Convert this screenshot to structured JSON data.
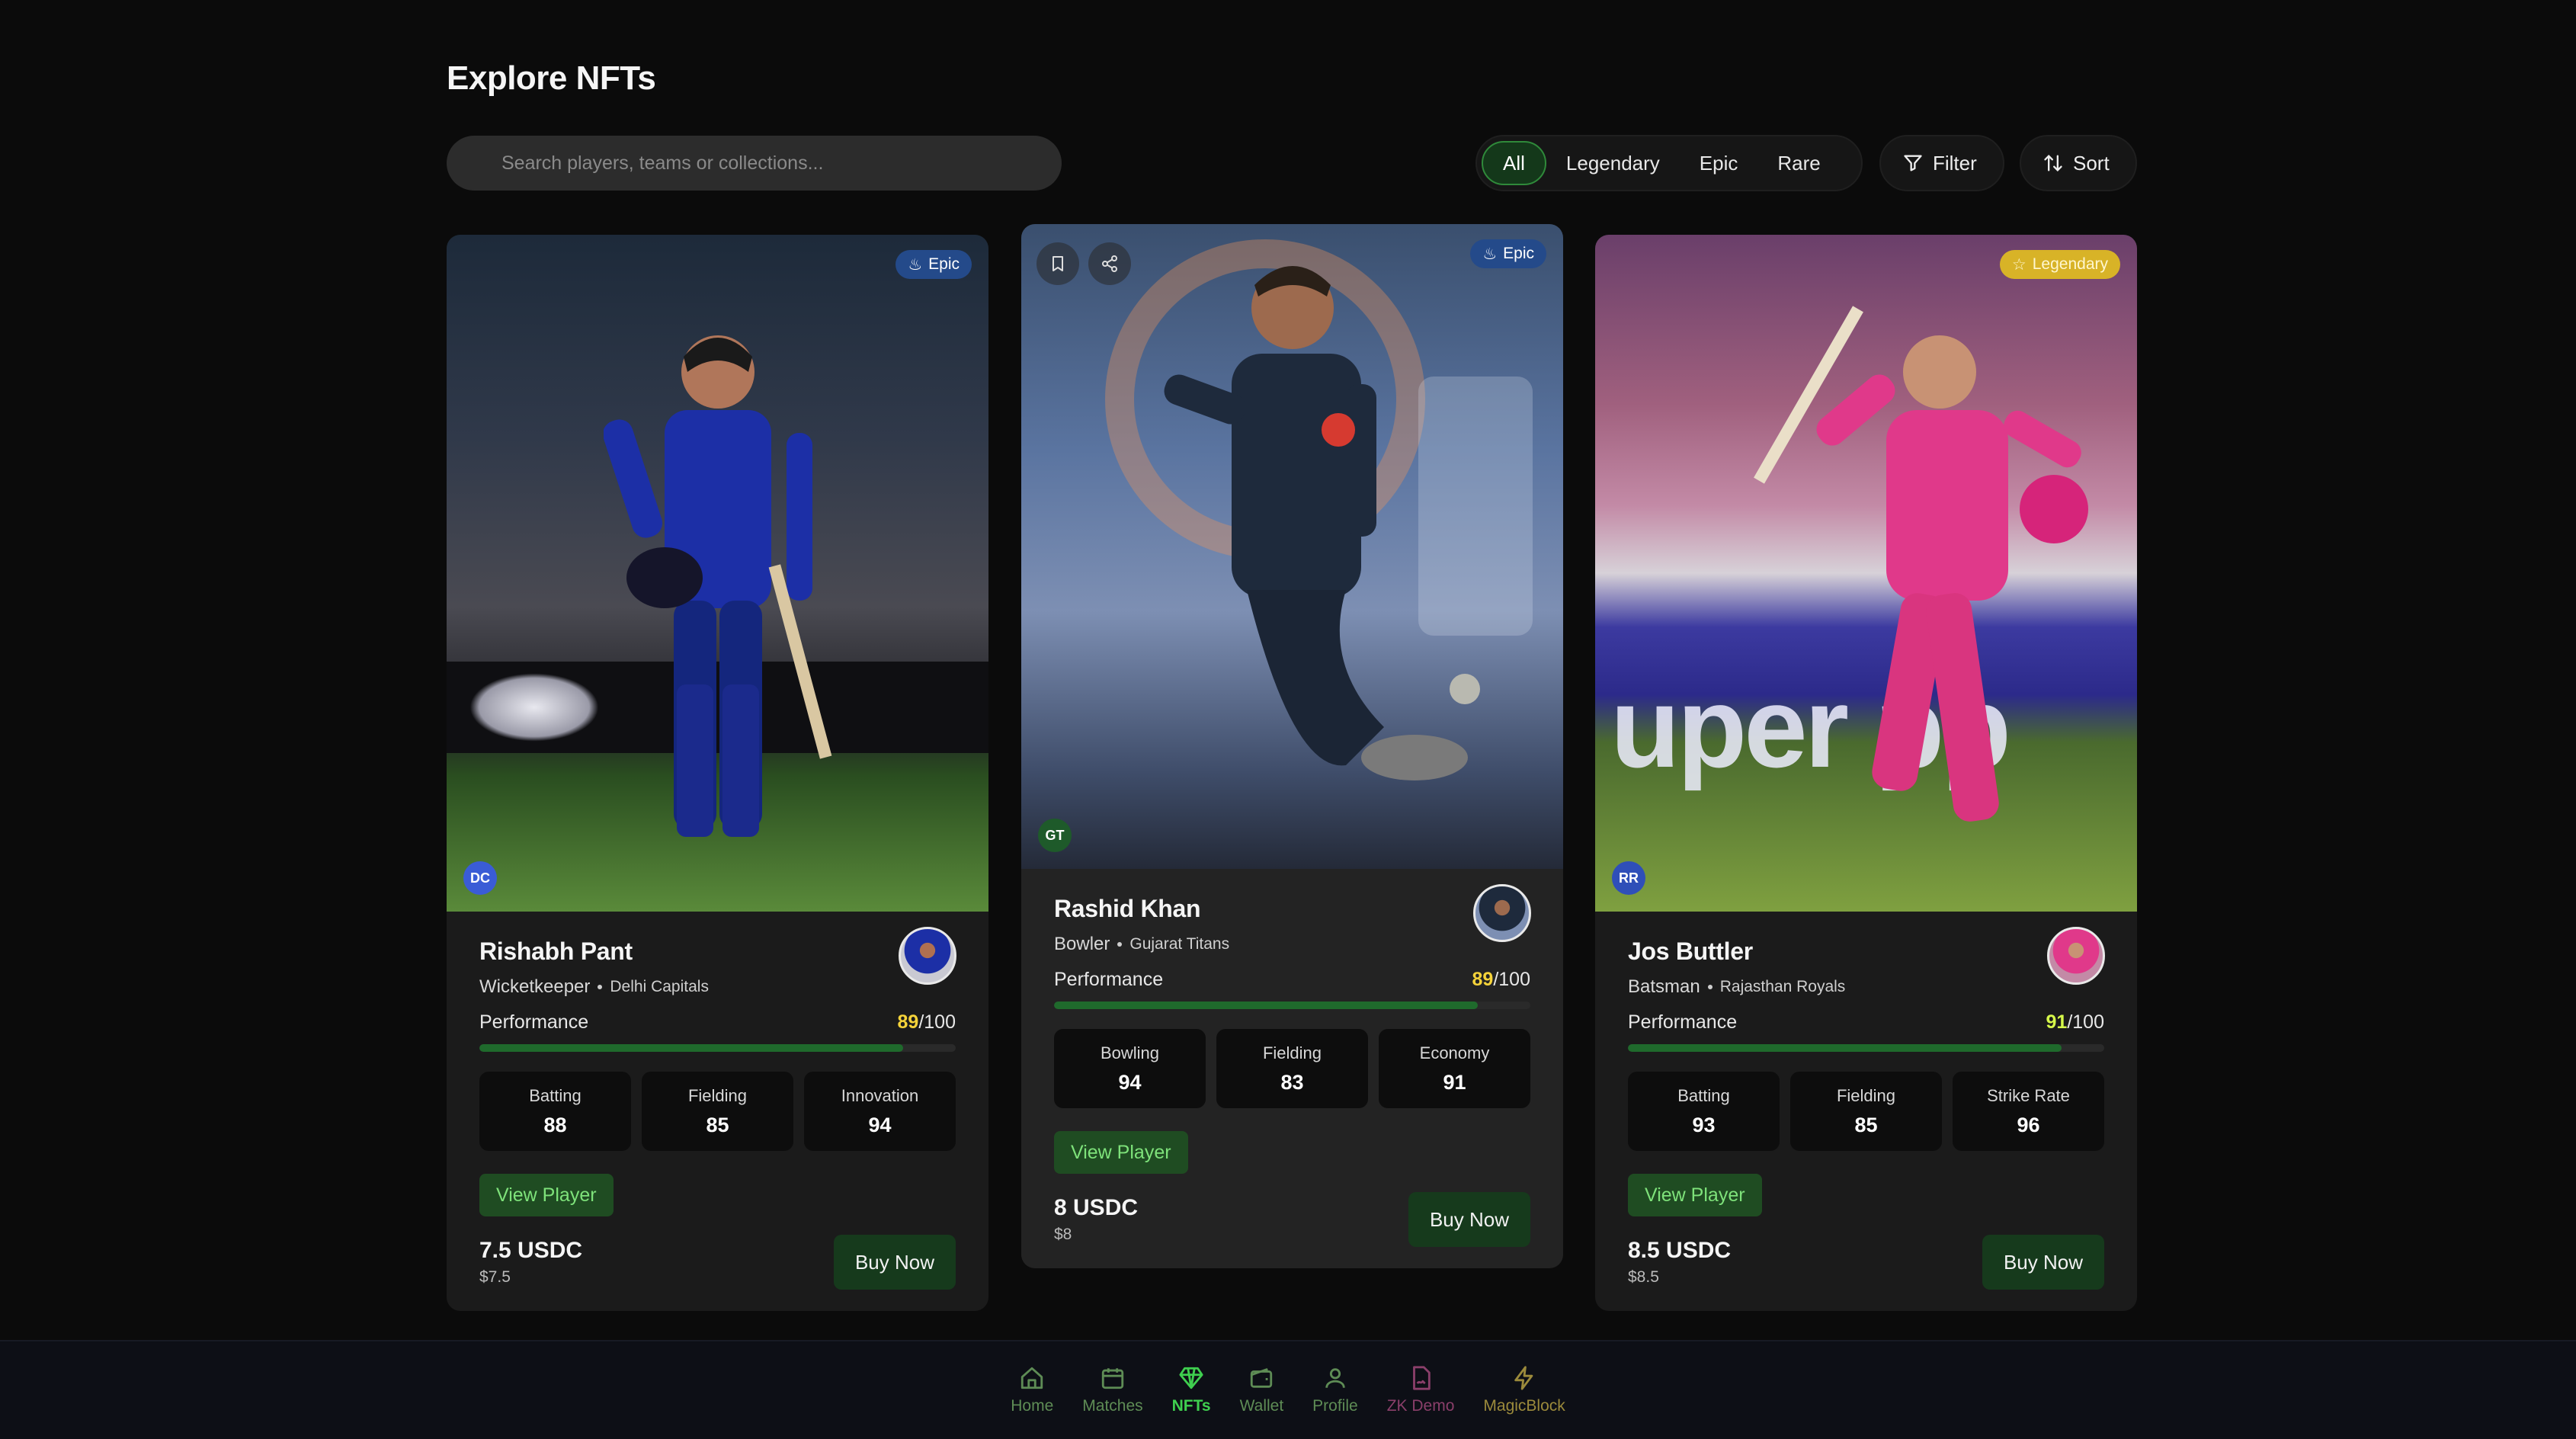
{
  "page": {
    "title": "Explore NFTs"
  },
  "search": {
    "placeholder": "Search players, teams or collections..."
  },
  "filters": {
    "tabs": [
      {
        "label": "All",
        "active": true
      },
      {
        "label": "Legendary",
        "active": false
      },
      {
        "label": "Epic",
        "active": false
      },
      {
        "label": "Rare",
        "active": false
      }
    ],
    "filter_label": "Filter",
    "sort_label": "Sort"
  },
  "cards": [
    {
      "name": "Rishabh Pant",
      "role": "Wicketkeeper",
      "team": "Delhi Capitals",
      "team_code": "DC",
      "rarity": "Epic",
      "performance_label": "Performance",
      "performance": 89,
      "performance_max": "/100",
      "stats": [
        {
          "label": "Batting",
          "value": "88"
        },
        {
          "label": "Fielding",
          "value": "85"
        },
        {
          "label": "Innovation",
          "value": "94"
        }
      ],
      "view_label": "View Player",
      "price": "7.5 USDC",
      "price_usd": "$7.5",
      "buy_label": "Buy Now"
    },
    {
      "name": "Rashid Khan",
      "role": "Bowler",
      "team": "Gujarat Titans",
      "team_code": "GT",
      "rarity": "Epic",
      "performance_label": "Performance",
      "performance": 89,
      "performance_max": "/100",
      "stats": [
        {
          "label": "Bowling",
          "value": "94"
        },
        {
          "label": "Fielding",
          "value": "83"
        },
        {
          "label": "Economy",
          "value": "91"
        }
      ],
      "view_label": "View Player",
      "price": "8 USDC",
      "price_usd": "$8",
      "buy_label": "Buy Now"
    },
    {
      "name": "Jos Buttler",
      "role": "Batsman",
      "team": "Rajasthan Royals",
      "team_code": "RR",
      "rarity": "Legendary",
      "performance_label": "Performance",
      "performance": 91,
      "performance_max": "/100",
      "stats": [
        {
          "label": "Batting",
          "value": "93"
        },
        {
          "label": "Fielding",
          "value": "85"
        },
        {
          "label": "Strike Rate",
          "value": "96"
        }
      ],
      "view_label": "View Player",
      "price": "8.5 USDC",
      "price_usd": "$8.5",
      "buy_label": "Buy Now"
    }
  ],
  "nav": [
    {
      "label": "Home",
      "icon": "home-icon"
    },
    {
      "label": "Matches",
      "icon": "calendar-icon"
    },
    {
      "label": "NFTs",
      "icon": "diamond-icon",
      "active": true
    },
    {
      "label": "Wallet",
      "icon": "wallet-icon"
    },
    {
      "label": "Profile",
      "icon": "user-icon"
    },
    {
      "label": "ZK Demo",
      "icon": "file-signature-icon"
    },
    {
      "label": "MagicBlock",
      "icon": "lightning-icon"
    }
  ],
  "colors": {
    "accent_green": "#3fcf4f",
    "epic_badge": "#244a8a",
    "legendary_badge": "#d8b327",
    "performance_score_yellow": "#f5d33a"
  }
}
